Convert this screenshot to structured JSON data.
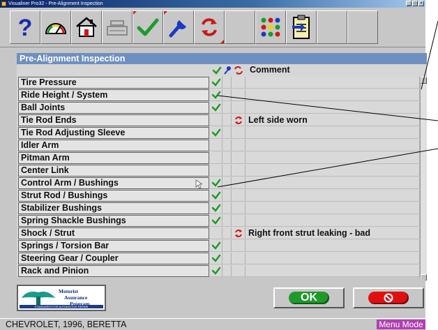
{
  "window": {
    "title": "Visualiner Pro32 - Pre-Alignment Inspection",
    "buttons": [
      "_",
      "□",
      "×"
    ]
  },
  "toolbar": {
    "buttons": [
      {
        "name": "help",
        "icon": "question-icon"
      },
      {
        "name": "alignment-gauge",
        "icon": "gauge-icon"
      },
      {
        "name": "home",
        "icon": "house-icon"
      },
      {
        "name": "print",
        "icon": "printer-icon",
        "disabled": true
      },
      {
        "name": "inspection-ok",
        "icon": "checkmark-icon"
      },
      {
        "name": "adjust",
        "icon": "wrench-icon"
      },
      {
        "name": "replace",
        "icon": "red-arrows-icon"
      },
      {
        "name": "blank",
        "icon": ""
      },
      {
        "name": "options",
        "icon": "dots-icon"
      },
      {
        "name": "clipboard",
        "icon": "clipboard-icon"
      }
    ]
  },
  "panel": {
    "title": "Pre-Alignment Inspection",
    "comment_header": "Comment"
  },
  "inspection_items": [
    {
      "label": "Tire Pressure",
      "ok": true,
      "replace": false,
      "comment": ""
    },
    {
      "label": "Ride Height / System",
      "ok": true,
      "replace": false,
      "comment": ""
    },
    {
      "label": "Ball Joints",
      "ok": true,
      "replace": false,
      "comment": ""
    },
    {
      "label": "Tie Rod Ends",
      "ok": false,
      "replace": true,
      "comment": "Left side worn"
    },
    {
      "label": "Tie Rod Adjusting Sleeve",
      "ok": true,
      "replace": false,
      "comment": ""
    },
    {
      "label": "Idler Arm",
      "ok": false,
      "replace": false,
      "comment": ""
    },
    {
      "label": "Pitman Arm",
      "ok": false,
      "replace": false,
      "comment": ""
    },
    {
      "label": "Center Link",
      "ok": false,
      "replace": false,
      "comment": ""
    },
    {
      "label": "Control Arm / Bushings",
      "ok": true,
      "replace": false,
      "comment": ""
    },
    {
      "label": "Strut Rod / Bushings",
      "ok": true,
      "replace": false,
      "comment": ""
    },
    {
      "label": "Stabilizer Bushings",
      "ok": true,
      "replace": false,
      "comment": ""
    },
    {
      "label": "Spring Shackle Bushings",
      "ok": true,
      "replace": false,
      "comment": ""
    },
    {
      "label": "Shock / Strut",
      "ok": false,
      "replace": true,
      "comment": "Right front strut leaking - bad"
    },
    {
      "label": "Springs / Torsion Bar",
      "ok": true,
      "replace": false,
      "comment": ""
    },
    {
      "label": "Steering Gear / Coupler",
      "ok": true,
      "replace": false,
      "comment": ""
    },
    {
      "label": "Rack and Pinion",
      "ok": true,
      "replace": false,
      "comment": ""
    }
  ],
  "logo": {
    "line1": "Motorist",
    "line2": "Assurance",
    "line3": "Program",
    "band": "STANDARDS FOR AUTOMOTIVE REPAIR"
  },
  "buttons": {
    "ok_label": "OK"
  },
  "status": {
    "vehicle": "CHEVROLET, 1996, BERETTA",
    "mode": "Menu Mode"
  },
  "colors": {
    "ok_green": "#1f9a2a",
    "replace_red": "#d01818",
    "adjust_blue": "#1a3ac0",
    "panel_title_bg": "#6f8fc0",
    "menu_mode_bg": "#b03fb0"
  }
}
